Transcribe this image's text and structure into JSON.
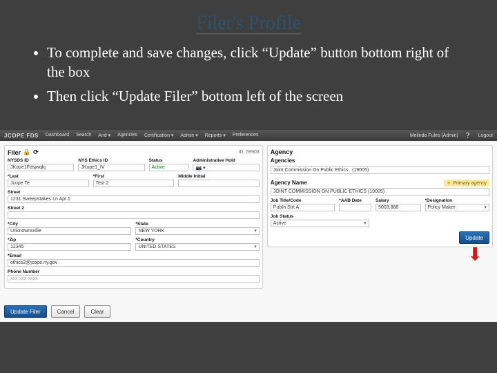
{
  "slide": {
    "title": "Filer's Profile",
    "bullets": [
      "To complete and save changes, click “Update” button bottom right of the box",
      "Then click “Update Filer” bottom left of the screen"
    ]
  },
  "app": {
    "brand": "JCOPE  FDS",
    "nav": [
      "Dashboard",
      "Search",
      "And ▾",
      "Agencies",
      "Certification ▾",
      "Admin ▾",
      "Reports ▾",
      "Preferences"
    ],
    "user": "Melinda Fules (Admin)",
    "logout": "Logout"
  },
  "filer": {
    "panel_title": "Filer",
    "id_label": "ID: 59903",
    "labels": {
      "nysds": "NYSDS ID",
      "nysethics": "NYS Ethics ID",
      "status": "Status",
      "adminhold": "Administrative Hold",
      "last": "*Last",
      "first": "*First",
      "middle": "Middle Initial",
      "street": "Street",
      "street2": "Street 2",
      "city": "*City",
      "state": "*State",
      "zip": "*Zip",
      "country": "*Country",
      "email": "*Email",
      "phone": "Phone Number"
    },
    "values": {
      "nysds": "JKope1Fdsjwqkj",
      "nysethics": "JKope1_IV",
      "status": "Active",
      "last": "Jcope Te",
      "first": "Test 2",
      "street": "1231 Sweepstakes Ln Apt 1",
      "city": "Unknownsville",
      "state": "NEW YORK",
      "zip": "12345",
      "country": "UNITED STATES",
      "email": "ethics2@jcope.ny.gov",
      "phone": "xxx-xxx-xxxx"
    }
  },
  "agency": {
    "panel_title": "Agency",
    "subhead": "Agencies",
    "selected": "Joint Commission On Public Ethics . (19005)",
    "primary_badge": "Primary agency",
    "labels": {
      "name": "Agency Name",
      "jobtitle": "Job Title/Code",
      "aabdate": "*AAB Date",
      "salary": "Salary",
      "designation": "*Designation",
      "jobstatus": "Job Status"
    },
    "values": {
      "name": "JOINT COMMISSION ON PUBLIC ETHICS (19005)",
      "jobtitle": "PubIn Strt A",
      "salary": "5003.888",
      "designation": "Policy Maker",
      "jobstatus": "Active"
    },
    "update_btn": "Update"
  },
  "footer": {
    "update_filer": "Update Filer",
    "cancel": "Cancel",
    "clear": "Clear"
  }
}
